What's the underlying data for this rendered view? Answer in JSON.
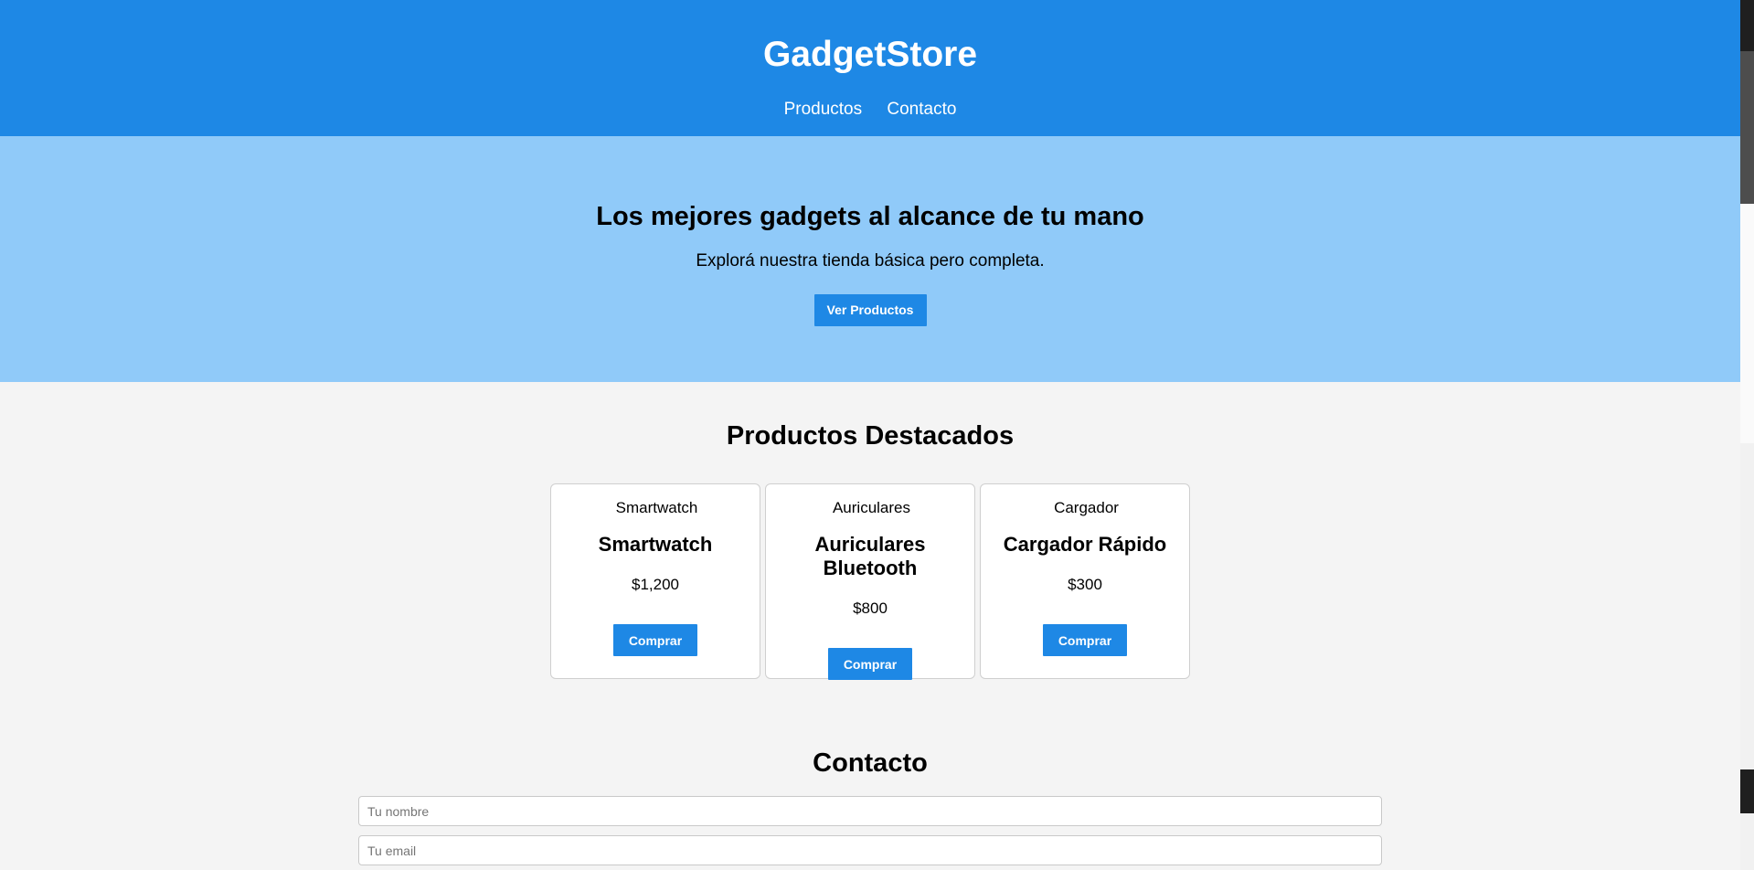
{
  "header": {
    "brand": "GadgetStore",
    "nav": [
      {
        "label": "Productos"
      },
      {
        "label": "Contacto"
      }
    ]
  },
  "hero": {
    "title": "Los mejores gadgets al alcance de tu mano",
    "subtitle": "Explorá nuestra tienda básica pero completa.",
    "cta_label": "Ver Productos"
  },
  "products": {
    "title": "Productos Destacados",
    "items": [
      {
        "image_alt": "Smartwatch",
        "name": "Smartwatch",
        "price": "$1,200",
        "buy_label": "Comprar"
      },
      {
        "image_alt": "Auriculares",
        "name": "Auriculares Bluetooth",
        "price": "$800",
        "buy_label": "Comprar"
      },
      {
        "image_alt": "Cargador",
        "name": "Cargador Rápido",
        "price": "$300",
        "buy_label": "Comprar"
      }
    ]
  },
  "contact": {
    "title": "Contacto",
    "name_placeholder": "Tu nombre",
    "email_placeholder": "Tu email"
  },
  "colors": {
    "primary": "#1e88e5",
    "hero_bg": "#90caf9",
    "page_bg": "#f4f4f4"
  }
}
